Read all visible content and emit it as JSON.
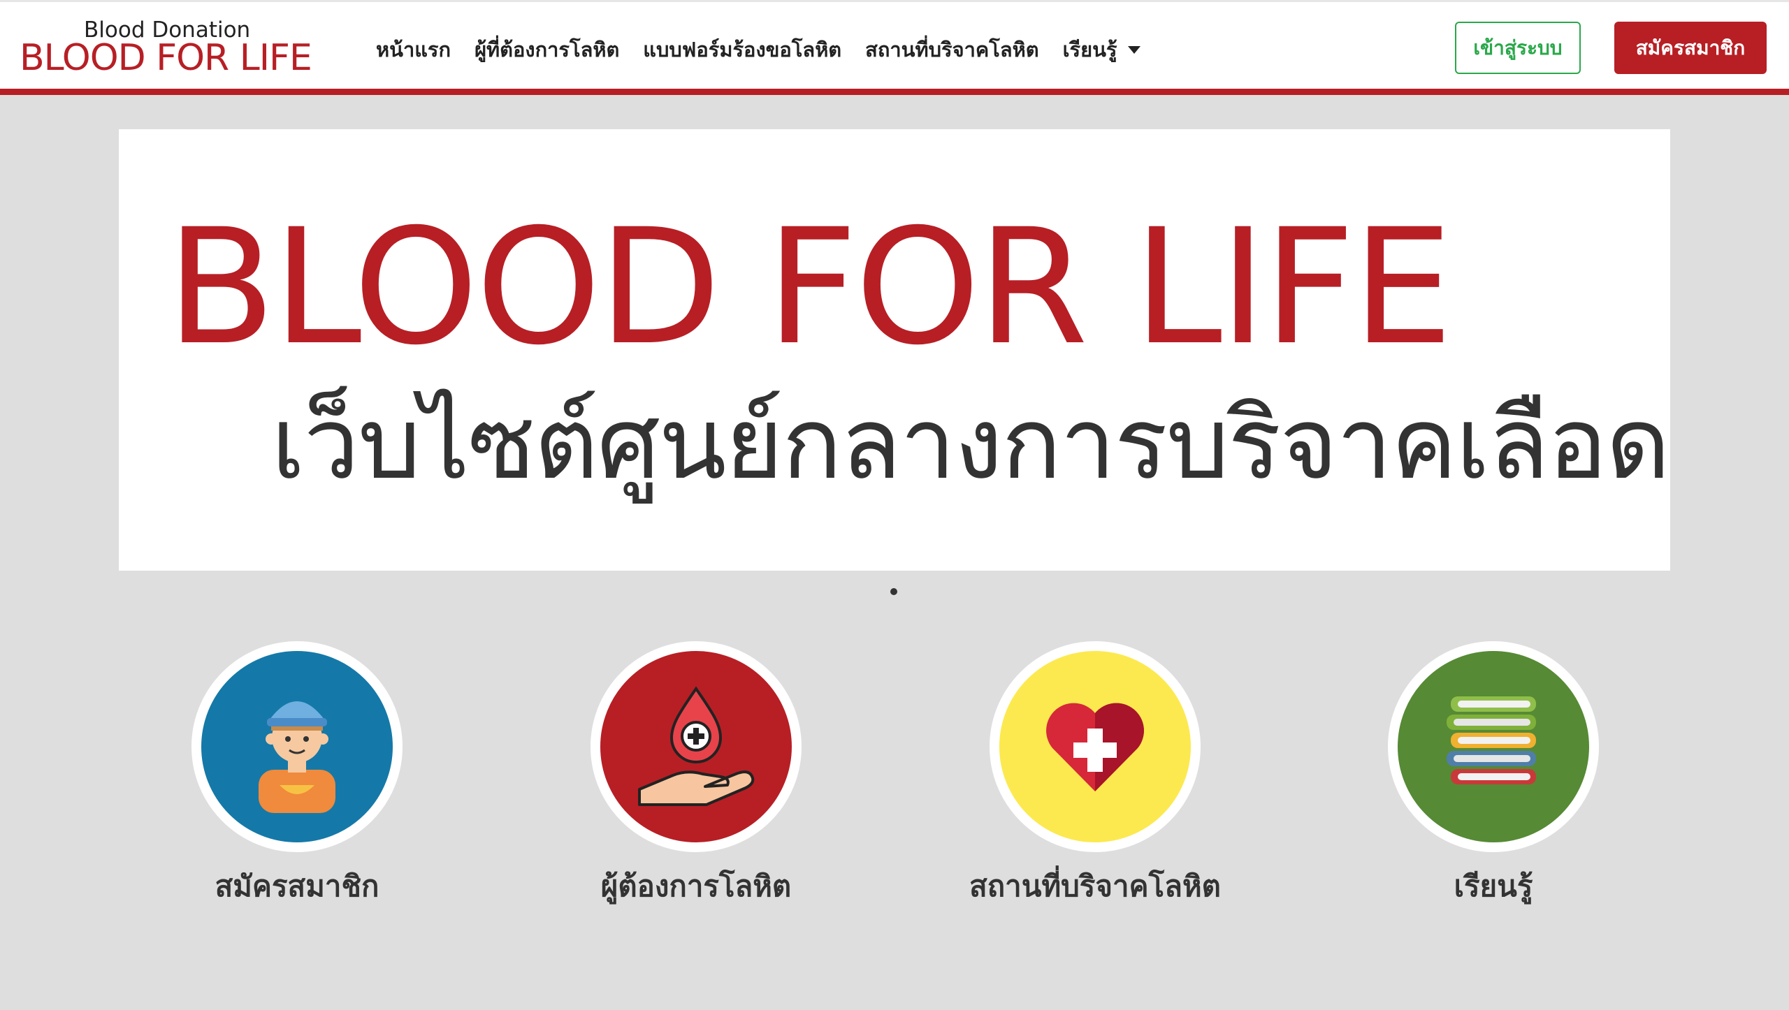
{
  "header": {
    "logo_small": "Blood Donation",
    "logo_big": "BLOOD FOR LIFE",
    "nav": [
      {
        "label": "หน้าแรก"
      },
      {
        "label": "ผู้ที่ต้องการโลหิต"
      },
      {
        "label": "แบบฟอร์มร้องขอโลหิต"
      },
      {
        "label": "สถานที่บริจาคโลหิต"
      },
      {
        "label": "เรียนรู้"
      }
    ],
    "login_label": "เข้าสู่ระบบ",
    "register_label": "สมัครสมาชิก"
  },
  "banner": {
    "title": "BLOOD FOR LIFE",
    "subtitle": "เว็บไซต์ศูนย์กลางการบริจาคเลือด"
  },
  "cards": [
    {
      "label": "สมัครสมาชิก",
      "icon": "member-icon",
      "color": "#1479a8"
    },
    {
      "label": "ผู้ต้องการโลหิต",
      "icon": "blood-drop-hand-icon",
      "color": "#b71f25"
    },
    {
      "label": "สถานที่บริจาคโลหิต",
      "icon": "heart-cross-icon",
      "color": "#fce94f"
    },
    {
      "label": "เรียนรู้",
      "icon": "books-icon",
      "color": "#568a35"
    }
  ],
  "colors": {
    "brand": "#b71f25",
    "login": "#2aa84a",
    "background": "#dedede"
  }
}
